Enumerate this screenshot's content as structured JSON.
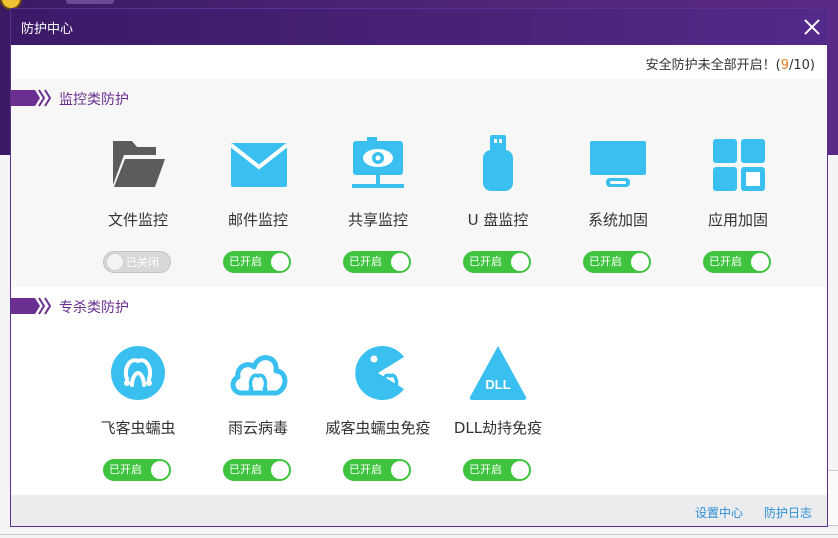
{
  "dialog": {
    "title": "防护中心",
    "status": {
      "prefix": "安全防护未全部开启！(",
      "enabled": "9",
      "separator": "/",
      "total": "10",
      "suffix": ")"
    }
  },
  "sections": [
    {
      "title": "监控类防护",
      "items": [
        {
          "label": "文件监控",
          "state": "已关闭",
          "on": false,
          "icon": "folder-icon"
        },
        {
          "label": "邮件监控",
          "state": "已开启",
          "on": true,
          "icon": "envelope-icon"
        },
        {
          "label": "共享监控",
          "state": "已开启",
          "on": true,
          "icon": "share-eye-icon"
        },
        {
          "label": "U 盘监控",
          "state": "已开启",
          "on": true,
          "icon": "usb-drive-icon"
        },
        {
          "label": "系统加固",
          "state": "已开启",
          "on": true,
          "icon": "monitor-icon"
        },
        {
          "label": "应用加固",
          "state": "已开启",
          "on": true,
          "icon": "app-grid-icon"
        }
      ]
    },
    {
      "title": "专杀类防护",
      "items": [
        {
          "label": "飞客虫蠕虫",
          "state": "已开启",
          "on": true,
          "icon": "worm-circle-icon"
        },
        {
          "label": "雨云病毒",
          "state": "已开启",
          "on": true,
          "icon": "worm-cloud-icon"
        },
        {
          "label": "威客虫蠕虫免疫",
          "state": "已开启",
          "on": true,
          "icon": "pacman-worm-icon"
        },
        {
          "label": "DLL劫持免疫",
          "state": "已开启",
          "on": true,
          "icon": "dll-triangle-icon",
          "badge": "DLL"
        }
      ]
    }
  ],
  "footer": {
    "settings": "设置中心",
    "log": "防护日志"
  },
  "colors": {
    "accent": "#6a2f90",
    "icon": "#3ac0f0",
    "iconDisabled": "#5c5c5c",
    "toggleOn": "#3ec43e",
    "link": "#2b8fd6"
  }
}
